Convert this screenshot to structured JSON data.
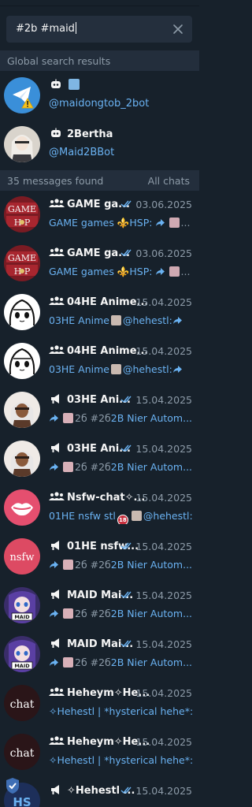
{
  "search": {
    "query": "#2b #maid"
  },
  "global_section": {
    "label": "Global search results"
  },
  "global_results": [
    {
      "name": " 🤖",
      "username": "@maidongtob_2bot",
      "avatar": "paper-plane"
    },
    {
      "name": "2Bertha",
      "username": "@Maid2BBot",
      "avatar": "anime-2b"
    }
  ],
  "messages_section": {
    "count_label": "35 messages found",
    "filter_label": "All chats"
  },
  "messages": [
    {
      "name": "GAME ga...",
      "date": "03.06.2025",
      "preview_a": "GAME games ⚜️HSP:",
      "preview_b": "...",
      "type": "group",
      "checks": true,
      "avatar": "game-hsp"
    },
    {
      "name": "GAME ga...",
      "date": "03.06.2025",
      "preview_a": "GAME games ⚜️HSP:",
      "preview_b": "...",
      "type": "group",
      "checks": true,
      "avatar": "game-hsp"
    },
    {
      "name": "04HE Anime...",
      "date": "15.04.2025",
      "preview_a": "03HE Anime",
      "preview_b": "@hehestl:",
      "type": "group",
      "checks": false,
      "avatar": "anime-line"
    },
    {
      "name": "04HE Anime...",
      "date": "15.04.2025",
      "preview_a": "03HE Anime",
      "preview_b": "@hehestl:",
      "type": "group",
      "checks": false,
      "avatar": "anime-line"
    },
    {
      "name": "03HE Ani...",
      "date": "15.04.2025",
      "preview_a": "2б #2б",
      "preview_b": "2B Nier Autom...",
      "type": "channel",
      "checks": true,
      "avatar": "anime-2b"
    },
    {
      "name": "03HE Ani...",
      "date": "15.04.2025",
      "preview_a": "2б #2б",
      "preview_b": "2B Nier Autom...",
      "type": "channel",
      "checks": true,
      "avatar": "anime-2b"
    },
    {
      "name": "Nsfw-chat✧...",
      "date": "15.04.2025",
      "preview_a": "01HE nsfw stl",
      "preview_b": "@hehestl:",
      "type": "group",
      "checks": false,
      "avatar": "lips"
    },
    {
      "name": "01HE nsfw...",
      "date": "15.04.2025",
      "preview_a": "2б #2б",
      "preview_b": "2B Nier Autom...",
      "type": "channel",
      "checks": true,
      "avatar": "nsfw"
    },
    {
      "name": "MAID Mai...",
      "date": "15.04.2025",
      "preview_a": "2б #2б",
      "preview_b": "2B Nier Autom...",
      "type": "channel",
      "checks": true,
      "avatar": "maid"
    },
    {
      "name": "MAID Mai...",
      "date": "15.04.2025",
      "preview_a": "2б #2б",
      "preview_b": "2B Nier Autom...",
      "type": "channel",
      "checks": true,
      "avatar": "maid"
    },
    {
      "name": "Heheym✧He...",
      "date": "15.04.2025",
      "preview_a": "✧Hehestl | *hysterical hehe*:",
      "preview_b": "",
      "type": "group",
      "checks": false,
      "avatar": "chat"
    },
    {
      "name": "Heheym✧He...",
      "date": "15.04.2025",
      "preview_a": "✧Hehestl | *hysterical hehe*:",
      "preview_b": "",
      "type": "group",
      "checks": false,
      "avatar": "chat"
    },
    {
      "name": "✧Hehestl ...",
      "date": "15.04.2025",
      "preview_a": "",
      "preview_b": "",
      "type": "channel",
      "checks": true,
      "avatar": "hs"
    }
  ],
  "colors": {
    "background": "#17212b",
    "section": "#232e3c",
    "accent": "#6ab2f2",
    "muted": "#8d9ba8"
  }
}
